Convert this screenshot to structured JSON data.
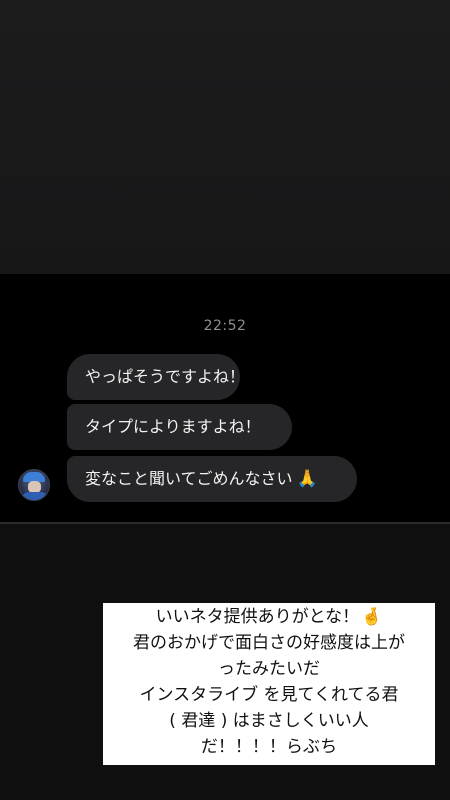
{
  "conversation": {
    "timestamp": "22:52",
    "messages": [
      {
        "text": "やっぱそうですよね！",
        "emoji": ""
      },
      {
        "text": "タイプによりますよね！",
        "emoji": ""
      },
      {
        "text": "変なこと聞いてごめんなさい",
        "emoji": "🙏"
      }
    ],
    "avatar_icon": "profile-avatar-icon"
  },
  "caption": {
    "lines": [
      "いいネタ提供ありがとな！",
      "君のおかげで面白さの好感度は上が",
      "ったみたいだ",
      "インスタライブ を見てくれてる君",
      "( 君達 ) はまさしくいい人",
      "だ！！！！らぶち"
    ],
    "line1_emoji": "🤞"
  },
  "colors": {
    "bubble": "#262628",
    "background": "#000000",
    "timestamp": "#8e8e93"
  }
}
